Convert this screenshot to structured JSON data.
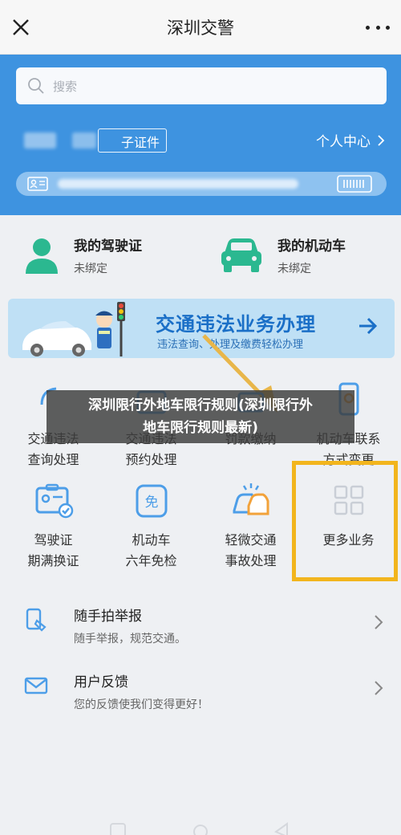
{
  "topbar": {
    "title": "深圳交警"
  },
  "header": {
    "search_placeholder": "搜索",
    "cert_label": "子证件",
    "center_label": "个人中心"
  },
  "licenses": [
    {
      "title": "我的驾驶证",
      "status": "未绑定"
    },
    {
      "title": "我的机动车",
      "status": "未绑定"
    }
  ],
  "banner": {
    "title": "交通违法业务办理",
    "subtitle": "违法查询、处理及缴费轻松办理"
  },
  "grid": {
    "row1": [
      {
        "l1": "交通违法",
        "l2": "查询处理"
      },
      {
        "l1": "交通违法",
        "l2": "预约处理"
      },
      {
        "l1": "",
        "l2": ""
      },
      {
        "l1": "机动车联系",
        "l2": "方式变更"
      }
    ],
    "row2": [
      {
        "l1": "驾驶证",
        "l2": "期满换证"
      },
      {
        "l1": "机动车",
        "l2": "六年免检"
      },
      {
        "l1": "轻微交通",
        "l2": "事故处理"
      },
      {
        "l1": "更多业务",
        "l2": ""
      }
    ],
    "row1_partial": "罚款缴纳"
  },
  "caption": {
    "line1": "深圳限行外地车限行规则(深圳限行外",
    "line2": "地车限行规则最新)"
  },
  "list": [
    {
      "title": "随手拍举报",
      "subtitle": "随手举报，规范交通。"
    },
    {
      "title": "用户反馈",
      "subtitle": "您的反馈使我们变得更好！"
    }
  ],
  "colors": {
    "brand_blue": "#3e93e0",
    "accent_green": "#2bb890",
    "highlight_yellow": "#f2b51d"
  }
}
